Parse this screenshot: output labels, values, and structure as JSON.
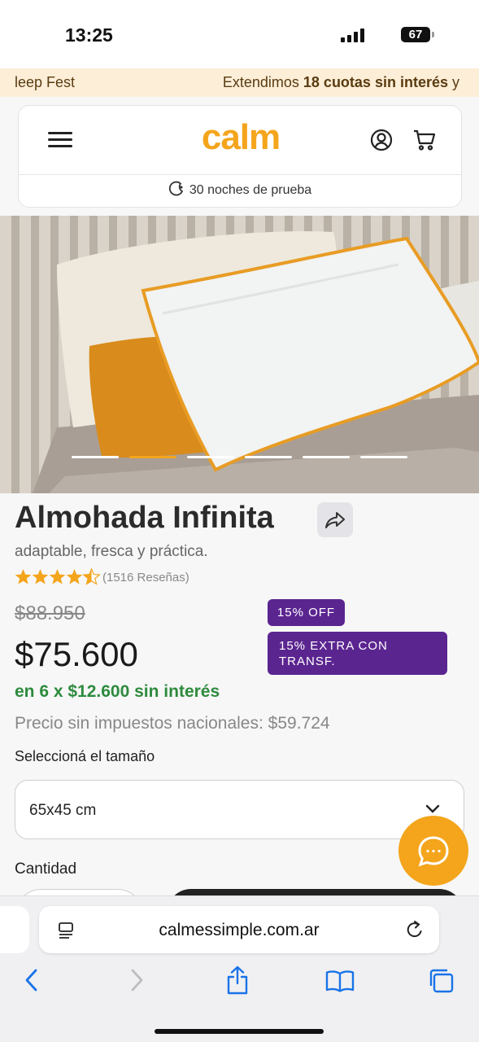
{
  "status": {
    "time": "13:25",
    "battery": "67"
  },
  "promo": {
    "left_text": "leep Fest",
    "right_prefix": "Extendimos ",
    "right_bold": "18 cuotas sin interés",
    "right_suffix": " y"
  },
  "header": {
    "logo": "calm",
    "trial": "30 noches de prueba",
    "accent_color": "#f4a51c"
  },
  "gallery": {
    "slide_count": 6,
    "active_slide": 2
  },
  "product": {
    "title": "Almohada Infinita",
    "subtitle": "adaptable, fresca y práctica.",
    "rating": 4.5,
    "reviews": "(1516 Reseñas)",
    "old_price": "$88.950",
    "price": "$75.600",
    "badge_off": "15% OFF",
    "badge_transfer": "15% EXTRA CON TRANSF.",
    "badge_color": "#5b2590",
    "installments": "en 6 x $12.600 sin interés",
    "tax_note": "Precio sin impuestos nacionales: $59.724",
    "size_label": "Seleccioná el tamaño",
    "size_value": "65x45 cm",
    "quantity_label": "Cantidad"
  },
  "browser": {
    "url": "calmessimple.com.ar"
  },
  "icons": {
    "menu": "hamburger-icon",
    "user": "user-icon",
    "cart": "cart-icon",
    "moon": "moon-icon",
    "share": "share-icon",
    "chat": "chat-icon",
    "chevron": "chevron-down-icon",
    "reader": "reader-icon",
    "reload": "reload-icon",
    "back": "back-icon",
    "forward": "forward-icon",
    "share_sheet": "share-sheet-icon",
    "bookmarks": "bookmarks-icon",
    "tabs": "tabs-icon"
  }
}
